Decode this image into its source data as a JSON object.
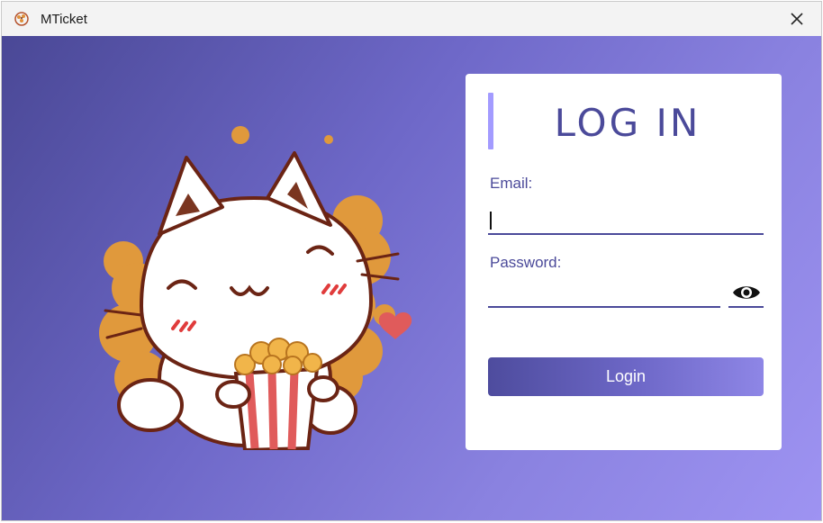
{
  "window": {
    "title": "MTicket",
    "icon": "popcorn-app-icon",
    "close_icon": "close-icon"
  },
  "background": {
    "gradient_from": "#4a4896",
    "gradient_to": "#9e93f2"
  },
  "illustration": {
    "name": "cat-with-popcorn"
  },
  "login_card": {
    "title": "LOG IN",
    "accent_color": "#a39bff",
    "email_label": "Email:",
    "email_value": "",
    "password_label": "Password:",
    "password_value": "",
    "show_password_icon": "eye-icon",
    "login_button": "Login",
    "text_color": "#4b4a9a"
  }
}
